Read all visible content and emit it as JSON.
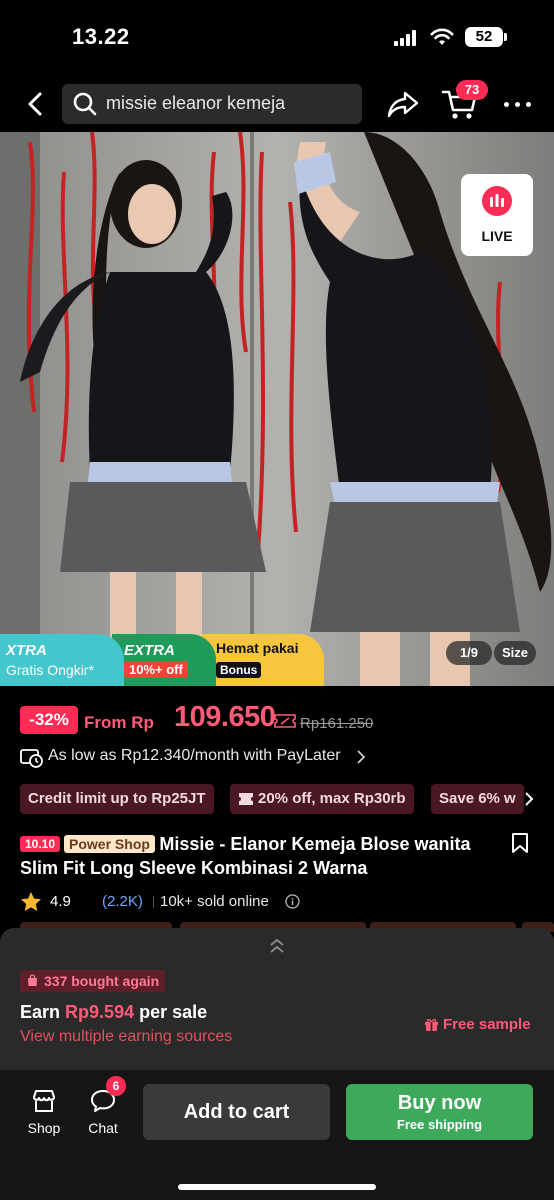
{
  "status_bar": {
    "time": "13.22",
    "battery": "52"
  },
  "nav": {
    "search_text": "missie eleanor kemeja",
    "cart_count": "73"
  },
  "gallery": {
    "live_label": "LIVE",
    "counter": "1/9",
    "size_label": "Size",
    "promos": {
      "xtra_title": "XTRA",
      "xtra_sub": "Gratis Ongkir*",
      "extra_title": "EXTRA",
      "extra_sub": "10%+ off",
      "hemat_title": "Hemat pakai",
      "hemat_sub": "Bonus"
    }
  },
  "price": {
    "discount": "-32%",
    "from_label": "From Rp",
    "amount": "109.650",
    "original": "Rp161.250"
  },
  "paylater": {
    "text": "As low as Rp12.340/month with PayLater"
  },
  "chips": [
    {
      "label": "Credit limit up to Rp25JT"
    },
    {
      "label": "20% off, max Rp30rb"
    },
    {
      "label": "Save 6% w"
    }
  ],
  "product": {
    "tag_event": "10.10",
    "tag_shop": "Power Shop",
    "title": "Missie - Elanor Kemeja Blose wanita Slim Fit Long Sleeve Kombinasi 2 Warna",
    "rating": "4.9",
    "rating_count": "(2.2K)",
    "sold": "10k+ sold online"
  },
  "affiliate": {
    "bought_again": "337 bought again",
    "earn_prefix": "Earn",
    "earn_amount": "Rp9.594",
    "earn_suffix": "per sale",
    "sources_link": "View multiple earning sources",
    "free_sample": "Free sample"
  },
  "bottom_bar": {
    "shop_label": "Shop",
    "chat_label": "Chat",
    "chat_badge": "6",
    "add_to_cart": "Add to cart",
    "buy_now": "Buy now",
    "buy_now_sub": "Free shipping"
  },
  "colors": {
    "accent": "#fe2c55",
    "price": "#ff5a77",
    "buy_now": "#3ea85b",
    "link": "#6aa8ff"
  }
}
